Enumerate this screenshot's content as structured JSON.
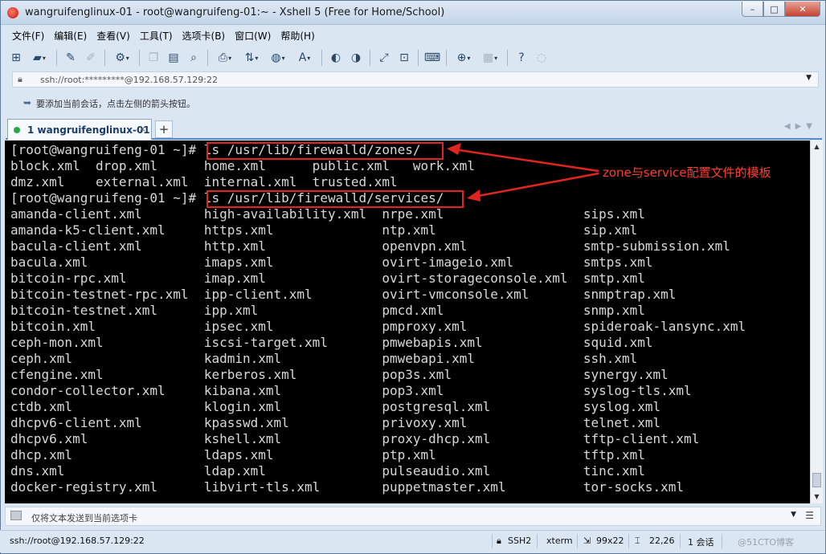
{
  "window": {
    "title": "wangruifenglinux-01 - root@wangruifeng-01:~ - Xshell 5 (Free for Home/School)",
    "controls": {
      "minimize": "–",
      "maximize": "□",
      "close": "✕"
    }
  },
  "menu": [
    "文件(F)",
    "编辑(E)",
    "查看(V)",
    "工具(T)",
    "选项卡(B)",
    "窗口(W)",
    "帮助(H)"
  ],
  "address": {
    "text": "ssh://root:*********@192.168.57.129:22"
  },
  "hint": {
    "text": "要添加当前会话，点击左侧的箭头按钮。"
  },
  "tab": {
    "label": "1 wangruifenglinux-01",
    "close": "×",
    "add": "+"
  },
  "terminal": {
    "lines": [
      "[root@wangruifeng-01 ~]# ls /usr/lib/firewalld/zones/",
      "block.xml  drop.xml      home.xml      public.xml   work.xml",
      "dmz.xml    external.xml  internal.xml  trusted.xml",
      "[root@wangruifeng-01 ~]# ls /usr/lib/firewalld/services/",
      "amanda-client.xml        high-availability.xml  nrpe.xml                  sips.xml",
      "amanda-k5-client.xml     https.xml              ntp.xml                   sip.xml",
      "bacula-client.xml        http.xml               openvpn.xml               smtp-submission.xml",
      "bacula.xml               imaps.xml              ovirt-imageio.xml         smtps.xml",
      "bitcoin-rpc.xml          imap.xml               ovirt-storageconsole.xml  smtp.xml",
      "bitcoin-testnet-rpc.xml  ipp-client.xml         ovirt-vmconsole.xml       snmptrap.xml",
      "bitcoin-testnet.xml      ipp.xml                pmcd.xml                  snmp.xml",
      "bitcoin.xml              ipsec.xml              pmproxy.xml               spideroak-lansync.xml",
      "ceph-mon.xml             iscsi-target.xml       pmwebapis.xml             squid.xml",
      "ceph.xml                 kadmin.xml             pmwebapi.xml              ssh.xml",
      "cfengine.xml             kerberos.xml           pop3s.xml                 synergy.xml",
      "condor-collector.xml     kibana.xml             pop3.xml                  syslog-tls.xml",
      "ctdb.xml                 klogin.xml             postgresql.xml            syslog.xml",
      "dhcpv6-client.xml        kpasswd.xml            privoxy.xml               telnet.xml",
      "dhcpv6.xml               kshell.xml             proxy-dhcp.xml            tftp-client.xml",
      "dhcp.xml                 ldaps.xml              ptp.xml                   tftp.xml",
      "dns.xml                  ldap.xml               pulseaudio.xml            tinc.xml",
      "docker-registry.xml      libvirt-tls.xml        puppetmaster.xml          tor-socks.xml"
    ]
  },
  "annotation": {
    "text": "zone与service配置文件的模板",
    "color": "#ff3c2e"
  },
  "sendbar": {
    "text": "仅将文本发送到当前选项卡"
  },
  "status": {
    "connection": "ssh://root@192.168.57.129:22",
    "protocol": "SSH2",
    "terminal_type": "xterm",
    "size": "99x22",
    "cursor": "22,26",
    "sessions": "1 会话",
    "watermark": "@51CTO博客"
  }
}
